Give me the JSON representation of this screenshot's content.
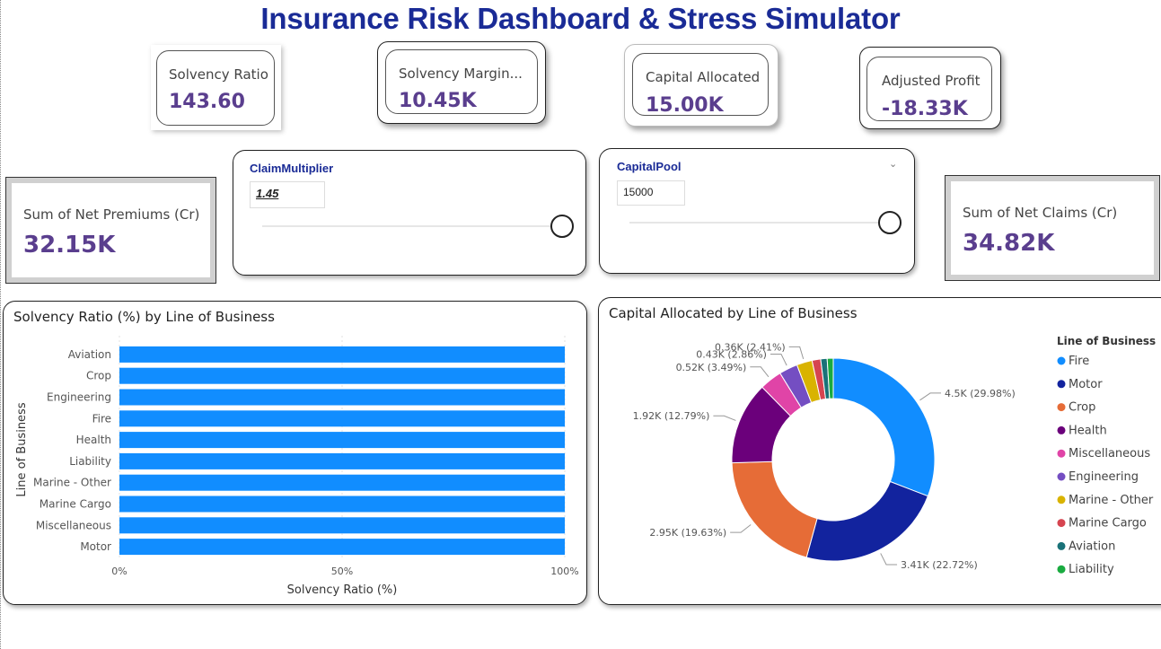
{
  "title": "Insurance Risk Dashboard & Stress Simulator",
  "kpis": {
    "solvency_ratio": {
      "label": "Solvency Ratio",
      "value": "143.60"
    },
    "solvency_margin": {
      "label": "Solvency Margin...",
      "value": "10.45K"
    },
    "capital_allocated": {
      "label": "Capital Allocated",
      "value": "15.00K"
    },
    "adjusted_profit": {
      "label": "Adjusted Profit",
      "value": "-18.33K"
    },
    "net_premiums": {
      "label": "Sum of Net Premiums (Cr)",
      "value": "32.15K"
    },
    "net_claims": {
      "label": "Sum of Net Claims (Cr)",
      "value": "34.82K"
    }
  },
  "slicers": {
    "claim_multiplier": {
      "title": "ClaimMultiplier",
      "value": "1.45"
    },
    "capital_pool": {
      "title": "CapitalPool",
      "value": "15000",
      "chevron_icon": "chevron-down-icon"
    }
  },
  "bar_chart": {
    "title": "Solvency Ratio (%) by Line of Business",
    "chart_data": {
      "type": "bar",
      "orientation": "horizontal",
      "categories": [
        "Aviation",
        "Crop",
        "Engineering",
        "Fire",
        "Health",
        "Liability",
        "Marine - Other",
        "Marine Cargo",
        "Miscellaneous",
        "Motor"
      ],
      "values": [
        100,
        100,
        100,
        100,
        100,
        100,
        100,
        100,
        100,
        100
      ],
      "xlabel": "Solvency Ratio (%)",
      "ylabel": "Line of Business",
      "xlim": [
        0,
        100
      ],
      "ticks": [
        "0%",
        "50%",
        "100%"
      ],
      "tick_values": [
        0,
        50,
        100
      ],
      "color": "#118dff"
    }
  },
  "donut_chart": {
    "title": "Capital Allocated by Line of Business",
    "chart_data": {
      "type": "pie",
      "donut": true,
      "legend_title": "Line of Business",
      "legend_position": "right",
      "slices": [
        {
          "name": "Fire",
          "value": 4.5,
          "label": "4.5K (29.98%)",
          "color": "#118dff"
        },
        {
          "name": "Motor",
          "value": 3.41,
          "label": "3.41K (22.72%)",
          "color": "#12239e"
        },
        {
          "name": "Crop",
          "value": 2.95,
          "label": "2.95K (19.63%)",
          "color": "#e66c37"
        },
        {
          "name": "Health",
          "value": 1.92,
          "label": "1.92K (12.79%)",
          "color": "#6b007b"
        },
        {
          "name": "Miscellaneous",
          "value": 0.52,
          "label": "0.52K (3.49%)",
          "color": "#e044a7"
        },
        {
          "name": "Engineering",
          "value": 0.43,
          "label": "0.43K (2.86%)",
          "color": "#744ec2"
        },
        {
          "name": "Marine - Other",
          "value": 0.36,
          "label": "0.36K (2.41%)",
          "color": "#d9b300"
        },
        {
          "name": "Marine Cargo",
          "value": 0.2,
          "label": "",
          "color": "#d64550"
        },
        {
          "name": "Aviation",
          "value": 0.15,
          "label": "",
          "color": "#197278"
        },
        {
          "name": "Liability",
          "value": 0.14,
          "label": "",
          "color": "#1aab40"
        }
      ]
    }
  }
}
